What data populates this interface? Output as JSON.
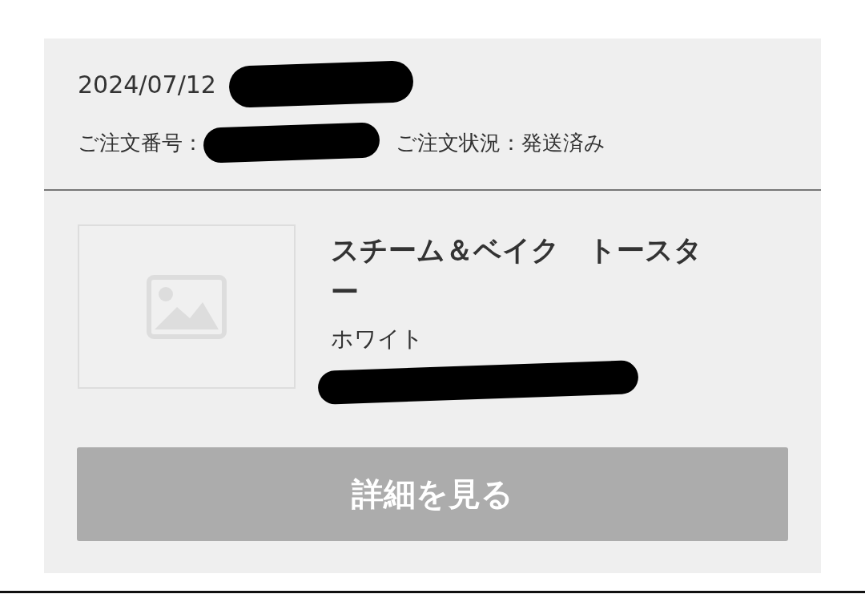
{
  "order": {
    "date": "2024/07/12",
    "number_label": "ご注文番号：",
    "status_label": "ご注文状況：",
    "status": "発送済み"
  },
  "product": {
    "name": "スチーム＆ベイク　トースター",
    "variant": "ホワイト"
  },
  "button": {
    "label": "詳細を見る",
    "disabled": true
  }
}
